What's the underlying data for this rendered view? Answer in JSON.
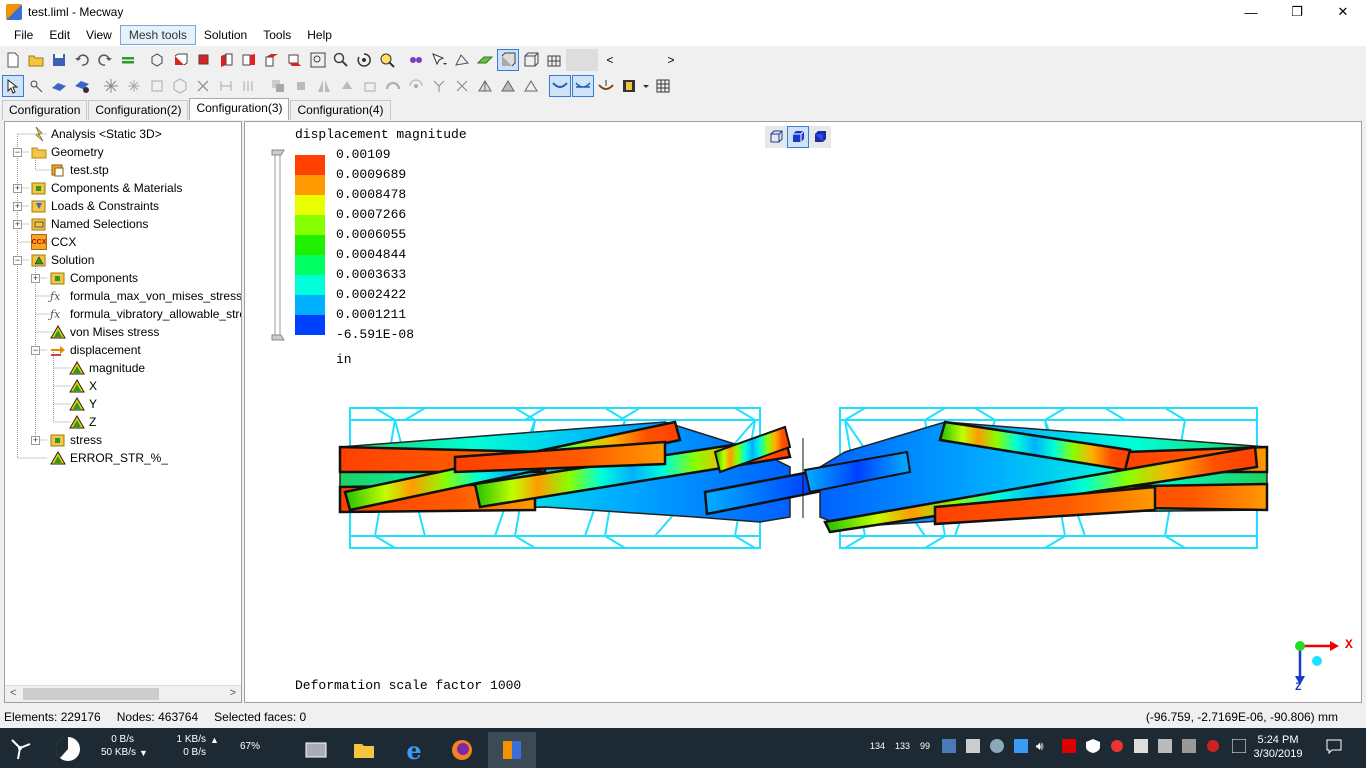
{
  "window": {
    "title": "test.liml - Mecway",
    "minimize": "—",
    "restore": "❐",
    "close": "✕"
  },
  "menu": [
    "File",
    "Edit",
    "View",
    "Mesh tools",
    "Solution",
    "Tools",
    "Help"
  ],
  "menu_active": "Mesh tools",
  "tabs": [
    "Configuration",
    "Configuration(2)",
    "Configuration(3)",
    "Configuration(4)"
  ],
  "active_tab": "Configuration(3)",
  "tree": {
    "analysis": "Analysis <Static 3D>",
    "geometry": "Geometry",
    "test_stp": "test.stp",
    "components_materials": "Components & Materials",
    "loads_constraints": "Loads & Constraints",
    "named_selections": "Named Selections",
    "ccx": "CCX",
    "ccx_icon_text": "CCX",
    "solution": "Solution",
    "components": "Components",
    "formula_max": "formula_max_von_mises_stress_",
    "formula_vib": "formula_vibratory_allowable_stre",
    "von_mises": "von Mises stress",
    "displacement": "displacement",
    "magnitude": "magnitude",
    "x": "X",
    "y": "Y",
    "z": "Z",
    "stress": "stress",
    "error_str": "ERROR_STR_%_"
  },
  "viewport": {
    "legend_title": "displacement magnitude",
    "legend_values": [
      "0.00109",
      "0.0009689",
      "0.0008478",
      "0.0007266",
      "0.0006055",
      "0.0004844",
      "0.0003633",
      "0.0002422",
      "0.0001211",
      "-6.591E-08"
    ],
    "legend_colors": [
      "#ff4000",
      "#ff9a00",
      "#e8ff00",
      "#88ff00",
      "#20f000",
      "#00ff60",
      "#00ffd8",
      "#00b0ff",
      "#0040ff"
    ],
    "unit": "in",
    "scale_label": "Deformation scale factor 1000",
    "axis_x": "X",
    "axis_z": "Z"
  },
  "status": {
    "elements": "Elements: 229176",
    "nodes": "Nodes: 463764",
    "selected": "Selected faces: 0",
    "coords": "(-96.759, -2.7169E-06, -90.806) mm"
  },
  "taskbar": {
    "net_up": "0 B/s",
    "net_down": "50 KB/s",
    "net_up2": "1 KB/s",
    "net_down2": "0 B/s",
    "cpu": "67%",
    "tray_nums": [
      "134",
      "133",
      "99"
    ],
    "time": "5:24 PM",
    "date": "3/30/2019"
  }
}
